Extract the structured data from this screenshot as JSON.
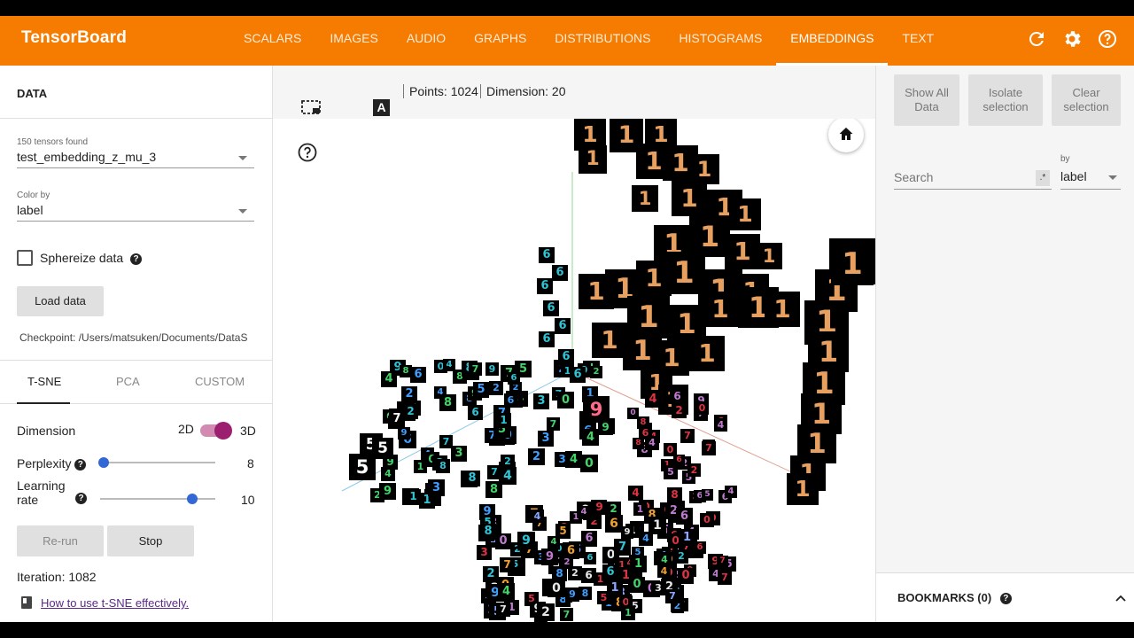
{
  "header": {
    "brand": "TensorBoard",
    "tabs": [
      "SCALARS",
      "IMAGES",
      "AUDIO",
      "GRAPHS",
      "DISTRIBUTIONS",
      "HISTOGRAMS",
      "EMBEDDINGS",
      "TEXT"
    ],
    "active_tab": "EMBEDDINGS",
    "icons": [
      "refresh-icon",
      "settings-icon",
      "help-icon"
    ],
    "accent": "#f57c00"
  },
  "data_panel": {
    "title": "DATA",
    "tensors_found": "150 tensors found",
    "tensor": "test_embedding_z_mu_3",
    "color_by_label": "Color by",
    "color_by": "label",
    "sphereize_label": "Sphereize data",
    "sphereize_checked": false,
    "load_button": "Load data",
    "checkpoint": "Checkpoint:  /Users/matsuken/Documents/DataS"
  },
  "projection": {
    "tabs": [
      "T-SNE",
      "PCA",
      "CUSTOM"
    ],
    "active": "T-SNE",
    "dimension_label": "Dimension",
    "dim_2d": "2D",
    "dim_3d": "3D",
    "dimension_value": "3D",
    "perplexity_label": "Perplexity",
    "perplexity_value": "8",
    "learning_rate_label": "Learning rate",
    "learning_rate_value": "10",
    "rerun_button": "Re-run",
    "stop_button": "Stop",
    "iteration": "Iteration: 1082",
    "howto_link": "How to use t-SNE effectively."
  },
  "toolbar": {
    "points": "Points: 1024",
    "dimension": "Dimension: 20",
    "icons": [
      "selection-box-icon",
      "night-mode-icon",
      "label-toggle-icon"
    ]
  },
  "canvas": {
    "icons": [
      "home-icon",
      "help-icon"
    ]
  },
  "inspector": {
    "show_all": "Show All Data",
    "isolate": "Isolate selection",
    "clear": "Clear selection",
    "search_placeholder": "Search",
    "regex_icon": ".*",
    "by_label": "by",
    "by_value": "label"
  },
  "bookmarks": {
    "title": "BOOKMARKS (0)"
  }
}
